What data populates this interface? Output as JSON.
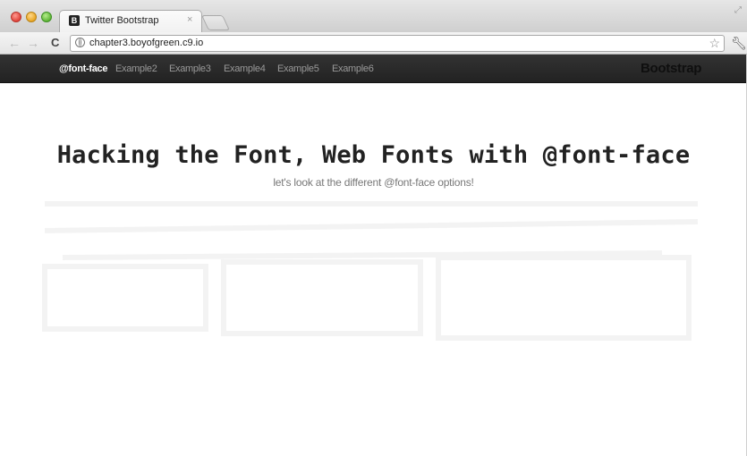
{
  "browser": {
    "tab_title": "Twitter Bootstrap",
    "tab_favicon": "B",
    "tab_close": "×",
    "url": "chapter3.boyofgreen.c9.io"
  },
  "navbar": {
    "items": [
      {
        "label": "@font-face",
        "active": true
      },
      {
        "label": "Example2",
        "active": false
      },
      {
        "label": "Example3",
        "active": false
      },
      {
        "label": "Example4",
        "active": false
      },
      {
        "label": "Example5",
        "active": false
      },
      {
        "label": "Example6",
        "active": false
      }
    ],
    "brand": "Bootstrap"
  },
  "hero": {
    "heading": "Hacking the Font, Web Fonts with @font-face",
    "subheading": "let's look at the different @font-face options!"
  },
  "icons": {
    "back": "back-arrow-icon",
    "forward": "forward-arrow-icon",
    "reload": "reload-icon",
    "site": "globe-icon",
    "bookmark": "star-icon",
    "menu": "wrench-icon"
  }
}
